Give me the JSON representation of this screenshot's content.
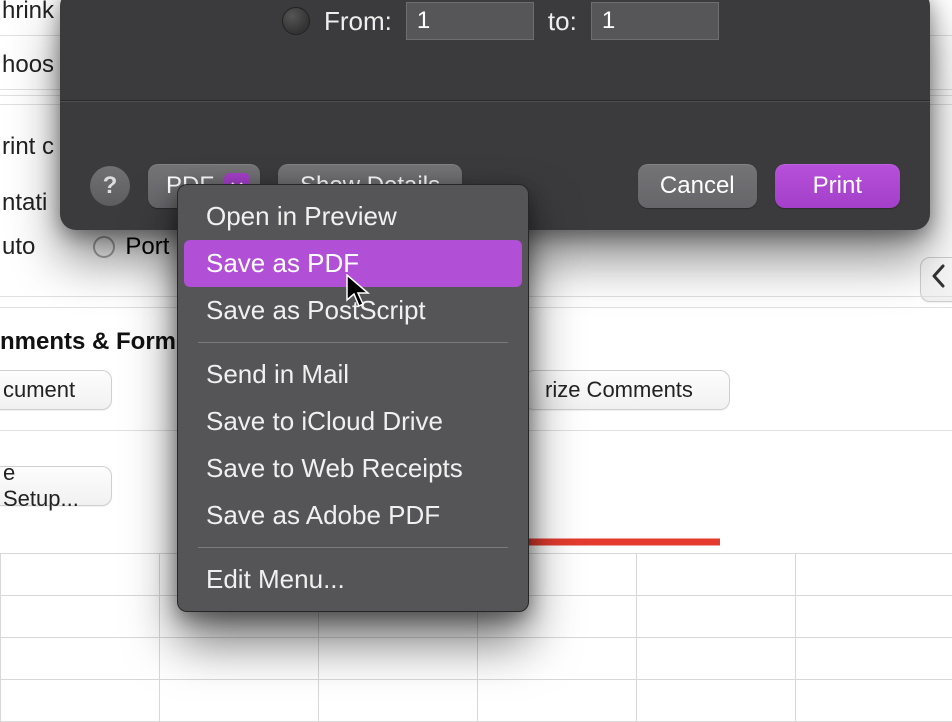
{
  "bg": {
    "opt_shrink": "hrink",
    "opt_choose": "hoos",
    "opt_print": "rint c",
    "opt_ntation": "ntati",
    "opt_auto": "uto",
    "radio_portrait": "Port",
    "section_comments": "nments & Form",
    "doc_select": "cument",
    "summarize_btn": "rize Comments",
    "page_setup_btn": "e Setup..."
  },
  "modal": {
    "range_from": "From:",
    "range_to": "to:",
    "from_val": "1",
    "to_val": "1",
    "help": "?",
    "pdf_btn": "PDF",
    "show_details": "Show Details",
    "cancel": "Cancel",
    "print": "Print"
  },
  "menu": {
    "open_preview": "Open in Preview",
    "save_pdf": "Save as PDF",
    "save_ps": "Save as PostScript",
    "send_mail": "Send in Mail",
    "save_icloud": "Save to iCloud Drive",
    "save_web": "Save to Web Receipts",
    "save_adobe": "Save as Adobe PDF",
    "edit_menu": "Edit Menu..."
  }
}
